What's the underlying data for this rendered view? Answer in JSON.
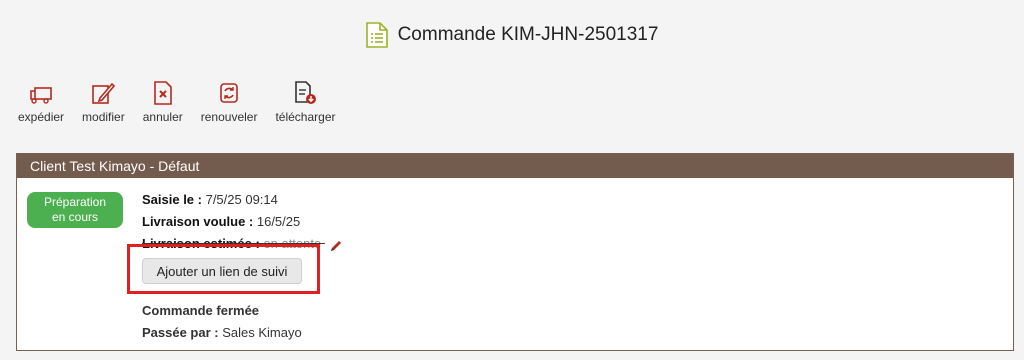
{
  "header": {
    "title": "Commande KIM-JHN-2501317",
    "icon": "document-list-icon"
  },
  "toolbar": {
    "items": [
      {
        "label": "expédier",
        "icon": "truck-icon"
      },
      {
        "label": "modifier",
        "icon": "edit-icon"
      },
      {
        "label": "annuler",
        "icon": "cancel-doc-icon"
      },
      {
        "label": "renouveler",
        "icon": "refresh-icon"
      },
      {
        "label": "télécharger",
        "icon": "download-doc-icon"
      }
    ]
  },
  "order": {
    "client": "Client Test Kimayo - Défaut",
    "status_line1": "Préparation",
    "status_line2": "en cours",
    "status_color": "#4caf50",
    "saisie_label": "Saisie le : ",
    "saisie_value": "7/5/25 09:14",
    "livraison_label": "Livraison voulue : ",
    "livraison_value": "16/5/25",
    "estimee_label": "Livraison estimée : ",
    "estimee_value": "en attente",
    "tracking_button": "Ajouter un lien de suivi",
    "closed_text": "Commande fermée",
    "passee_label": "Passée par : ",
    "passee_value": "Sales Kimayo"
  },
  "colors": {
    "panel_header": "#735b4d",
    "highlight": "#e02020",
    "icon_red": "#b52a1f"
  }
}
